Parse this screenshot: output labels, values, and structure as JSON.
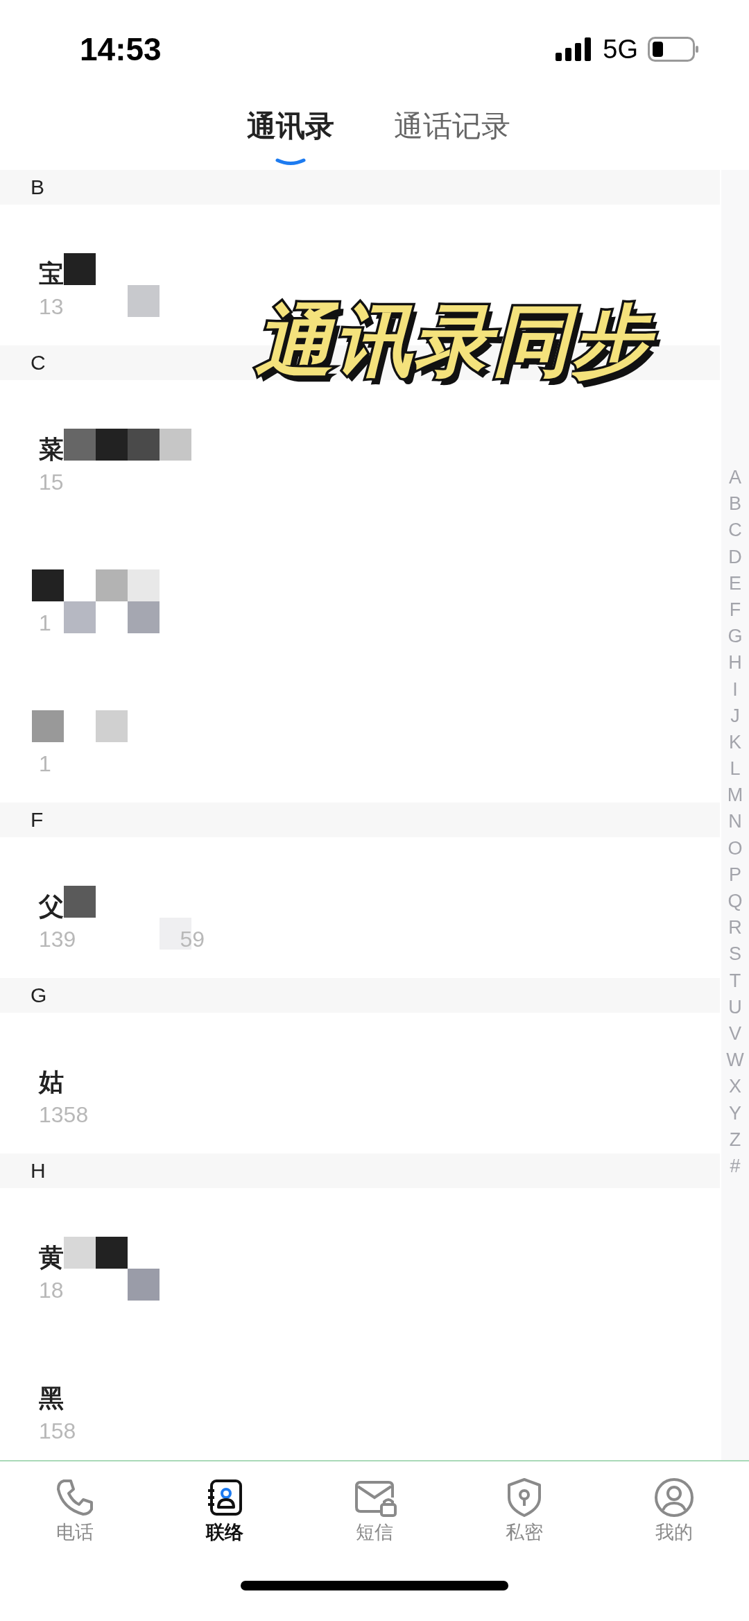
{
  "status_bar": {
    "time": "14:53",
    "network": "5G"
  },
  "tabs": [
    {
      "label": "通讯录",
      "selected": true
    },
    {
      "label": "通话记录",
      "selected": false
    }
  ],
  "sections": [
    {
      "letter": "B",
      "contacts": [
        {
          "name": "宝",
          "number": [
            "13"
          ],
          "mosaic": [
            [
              {
                "kind": "gap"
              },
              {
                "kind": "tile",
                "color": "#222222"
              }
            ],
            [
              {
                "kind": "gap"
              },
              {
                "kind": "gap"
              },
              {
                "kind": "gap"
              },
              {
                "kind": "tile",
                "color": "#c8c9cd"
              }
            ]
          ]
        }
      ]
    },
    {
      "letter": "C",
      "contacts": [
        {
          "name": "菜",
          "number": [
            "15"
          ],
          "mosaic": [
            [
              {
                "kind": "gap"
              },
              {
                "kind": "tile",
                "color": "#666666"
              },
              {
                "kind": "tile",
                "color": "#222222"
              },
              {
                "kind": "tile",
                "color": "#4a4a4a"
              },
              {
                "kind": "tile",
                "color": "#c6c6c6"
              }
            ]
          ]
        },
        {
          "number": [
            "1"
          ],
          "mosaic": [
            [
              {
                "kind": "tile",
                "color": "#222222"
              },
              {
                "kind": "gap"
              },
              {
                "kind": "tile",
                "color": "#b3b3b3"
              },
              {
                "kind": "tile",
                "color": "#e8e8e8"
              }
            ],
            [
              {
                "kind": "gap"
              },
              {
                "kind": "tile",
                "color": "#b6b8c2"
              },
              {
                "kind": "gap"
              },
              {
                "kind": "tile",
                "color": "#a5a7b1"
              }
            ]
          ]
        },
        {
          "number": [
            "1"
          ],
          "mosaic": [
            [
              {
                "kind": "tile",
                "color": "#999999"
              },
              {
                "kind": "gap"
              },
              {
                "kind": "tile",
                "color": "#d0d0d0"
              }
            ]
          ]
        }
      ]
    },
    {
      "letter": "F",
      "contacts": [
        {
          "name": "父",
          "number": [
            "139",
            "59"
          ],
          "mosaic": [
            [
              {
                "kind": "gap"
              },
              {
                "kind": "tile",
                "color": "#5a5a5a"
              }
            ],
            [
              {
                "kind": "gap"
              },
              {
                "kind": "gap"
              },
              {
                "kind": "gap"
              },
              {
                "kind": "gap"
              },
              {
                "kind": "tile",
                "color": "#efeff1"
              }
            ]
          ]
        }
      ]
    },
    {
      "letter": "G",
      "contacts": [
        {
          "name": "姑",
          "number": [
            "1358"
          ]
        }
      ]
    },
    {
      "letter": "H",
      "contacts": [
        {
          "name": "黄",
          "number": [
            "18"
          ],
          "mosaic": [
            [
              {
                "kind": "gap"
              },
              {
                "kind": "tile",
                "color": "#d8d8d8"
              },
              {
                "kind": "tile",
                "color": "#222222"
              }
            ],
            [
              {
                "kind": "gap"
              },
              {
                "kind": "gap"
              },
              {
                "kind": "gap"
              },
              {
                "kind": "tile",
                "color": "#9a9ca8"
              }
            ]
          ]
        },
        {
          "name": "黑",
          "number": [
            "158"
          ]
        }
      ]
    }
  ],
  "overlay_caption": "通讯录同步",
  "index_letters": [
    "A",
    "B",
    "C",
    "D",
    "E",
    "F",
    "G",
    "H",
    "I",
    "J",
    "K",
    "L",
    "M",
    "N",
    "O",
    "P",
    "Q",
    "R",
    "S",
    "T",
    "U",
    "V",
    "W",
    "X",
    "Y",
    "Z",
    "#"
  ],
  "bottom_nav": [
    {
      "label": "电话",
      "selected": false
    },
    {
      "label": "联络",
      "selected": true
    },
    {
      "label": "短信",
      "selected": false
    },
    {
      "label": "私密",
      "selected": false
    },
    {
      "label": "我的",
      "selected": false
    }
  ]
}
